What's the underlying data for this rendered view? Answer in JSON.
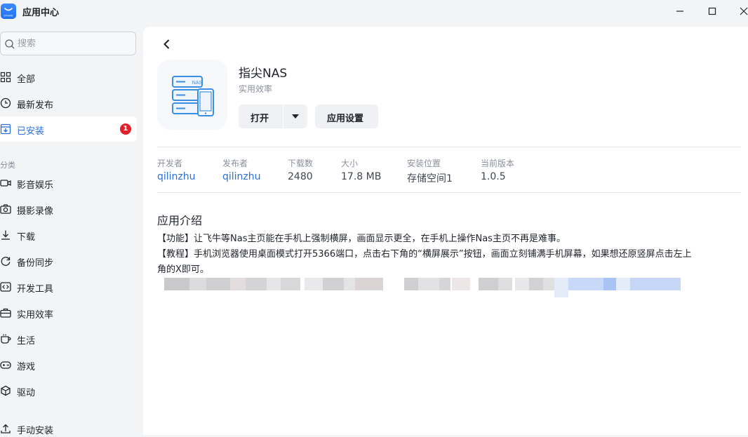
{
  "window": {
    "title": "应用中心",
    "logo_text": "STORE"
  },
  "sidebar": {
    "search_placeholder": "搜索",
    "items": [
      {
        "label": "全部",
        "icon": "grid-icon"
      },
      {
        "label": "最新发布",
        "icon": "clock-icon"
      },
      {
        "label": "已安装",
        "icon": "installed-icon",
        "badge": "1",
        "active": true
      }
    ],
    "category_label": "分类",
    "categories": [
      {
        "label": "影音娱乐",
        "icon": "video-icon"
      },
      {
        "label": "摄影录像",
        "icon": "camera-icon"
      },
      {
        "label": "下载",
        "icon": "download-icon"
      },
      {
        "label": "备份同步",
        "icon": "sync-icon"
      },
      {
        "label": "开发工具",
        "icon": "code-icon"
      },
      {
        "label": "实用效率",
        "icon": "briefcase-icon"
      },
      {
        "label": "生活",
        "icon": "cup-icon"
      },
      {
        "label": "游戏",
        "icon": "gamepad-icon"
      },
      {
        "label": "驱动",
        "icon": "cube-icon"
      }
    ],
    "manual_install": {
      "label": "手动安装",
      "icon": "upload-icon"
    }
  },
  "app": {
    "name": "指尖NAS",
    "category": "实用效率",
    "icon_text": "NAS",
    "open_label": "打开",
    "settings_label": "应用设置",
    "meta": [
      {
        "label": "开发者",
        "value": "qilinzhu",
        "link": true
      },
      {
        "label": "发布者",
        "value": "qilinzhu",
        "link": true
      },
      {
        "label": "下载数",
        "value": "2480"
      },
      {
        "label": "大小",
        "value": "17.8 MB"
      },
      {
        "label": "安装位置",
        "value": "存储空间1"
      },
      {
        "label": "当前版本",
        "value": "1.0.5"
      }
    ],
    "description_title": "应用介绍",
    "description": {
      "line1_tag": "【功能】",
      "line1": "让飞牛等Nas主页能在手机上强制横屏，画面显示更全，在手机上操作Nas主页不再是难事。",
      "line2_tag": "【教程】",
      "line2": "手机浏览器使用桌面模式打开5366端口，点击右下角的“横屏展示”按钮，画面立刻铺满手机屏幕，如果想还原竖屏点击左上",
      "line3": "角的X即可。"
    }
  },
  "colors": {
    "accent": "#2b6fd6",
    "badge": "#e0202a",
    "background": "#f3f4f6",
    "panel": "#ffffff"
  }
}
